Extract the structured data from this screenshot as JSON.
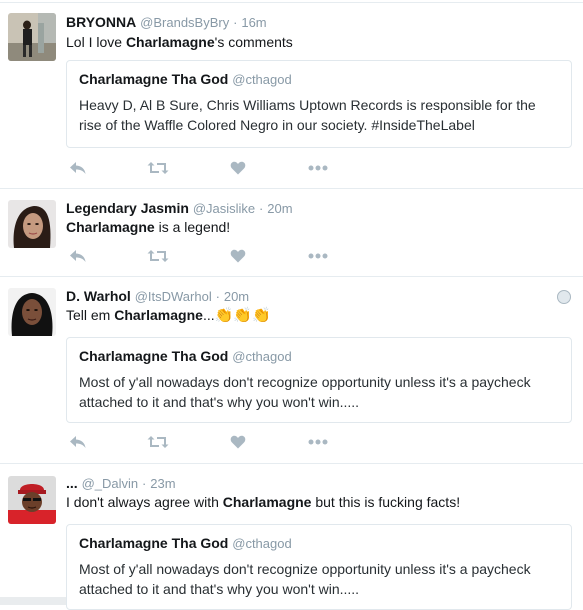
{
  "tweets": [
    {
      "name": "BRYONNA",
      "handle": "@BrandsByBry",
      "dot": "·",
      "time": "16m",
      "text": {
        "before": "Lol I love ",
        "bold": "Charlamagne",
        "after": "'s comments"
      },
      "quote": {
        "name": "Charlamagne Tha God",
        "handle": "@cthagod",
        "text": "Heavy D, Al B Sure, Chris Williams Uptown Records is responsible for the rise of the Waffle Colored Negro in our society. #InsideTheLabel"
      }
    },
    {
      "name": "Legendary Jasmin",
      "handle": "@Jasislike",
      "dot": "·",
      "time": "20m",
      "text": {
        "before": "",
        "bold": "Charlamagne",
        "after": " is a legend!"
      }
    },
    {
      "name": "D. Warhol",
      "handle": "@ItsDWarhol",
      "dot": "·",
      "time": "20m",
      "text": {
        "before": "Tell em ",
        "bold": "Charlamagne",
        "after": "..."
      },
      "emoji": "👏👏👏",
      "quote": {
        "name": "Charlamagne Tha God",
        "handle": "@cthagod",
        "text": "Most of y'all nowadays don't recognize opportunity unless it's a paycheck attached to it and that's why you won't win....."
      }
    },
    {
      "name": "...",
      "handle": "@_Dalvin",
      "dot": "·",
      "time": "23m",
      "text": {
        "before": "I don't always agree with ",
        "bold": "Charlamagne",
        "after": " but this is fucking facts!"
      },
      "quote": {
        "name": "Charlamagne Tha God",
        "handle": "@cthagod",
        "text": "Most of y'all nowadays don't recognize opportunity unless it's a paycheck attached to it and that's why you won't win....."
      }
    }
  ],
  "icons": {
    "reply": "reply-icon",
    "retweet": "retweet-icon",
    "like": "heart-icon",
    "more": "more-icon",
    "globe": "globe-icon"
  },
  "colors": {
    "icon": "#aab8c2",
    "secondary_text": "#8899a6",
    "border": "#e1e8ed"
  }
}
